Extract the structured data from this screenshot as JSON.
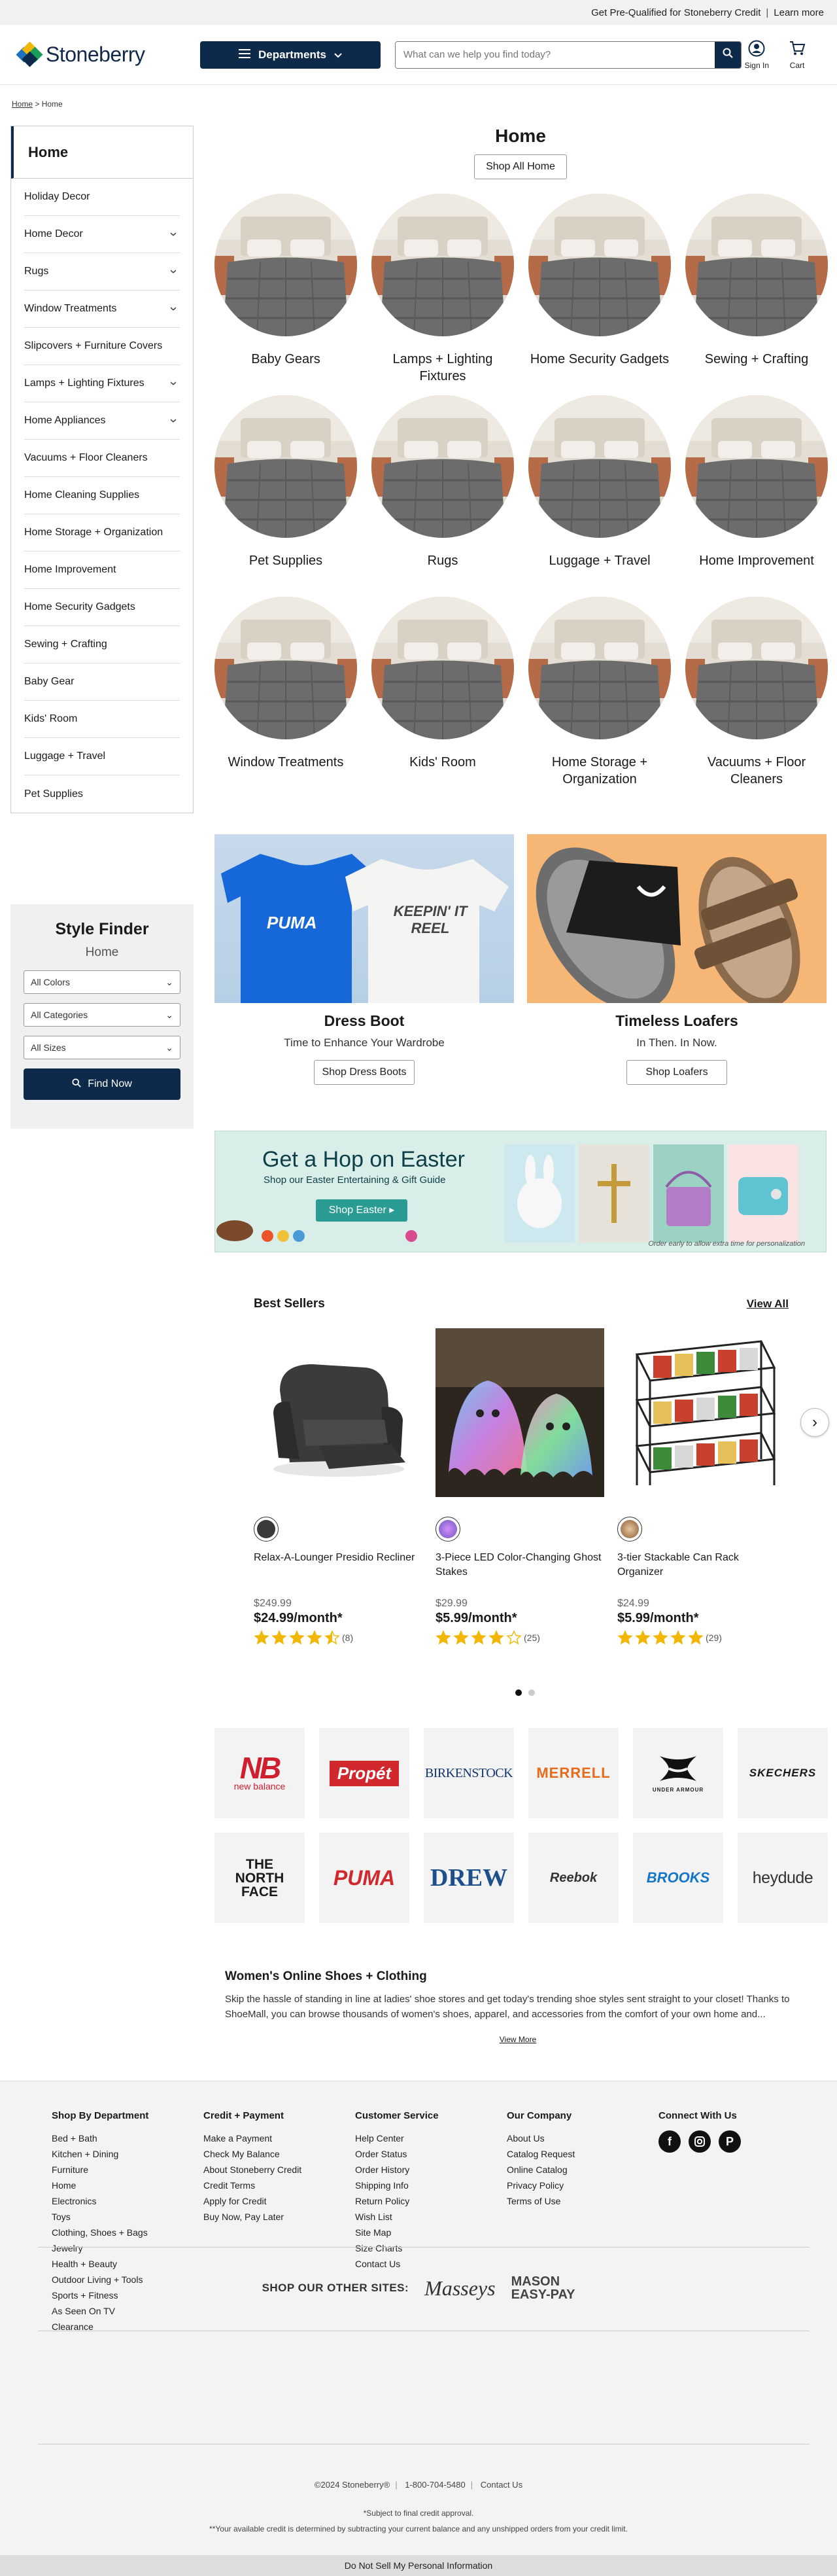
{
  "topbar": {
    "credit_text": "Get Pre-Qualified for Stoneberry Credit",
    "sep": "|",
    "learn_more": "Learn more"
  },
  "header": {
    "logo_text": "Stoneberry",
    "departments_label": "Departments",
    "search_placeholder": "What can we help you find today?",
    "signin_label": "Sign In",
    "cart_label": "Cart"
  },
  "breadcrumb": {
    "home": "Home",
    "sep": ">",
    "current": "Home"
  },
  "sidebar": {
    "title": "Home",
    "items": [
      {
        "label": "Holiday Decor",
        "expandable": false
      },
      {
        "label": "Home Decor",
        "expandable": true
      },
      {
        "label": "Rugs",
        "expandable": true
      },
      {
        "label": "Window Treatments",
        "expandable": true
      },
      {
        "label": "Slipcovers + Furniture Covers",
        "expandable": false
      },
      {
        "label": "Lamps + Lighting Fixtures",
        "expandable": true
      },
      {
        "label": "Home Appliances",
        "expandable": true
      },
      {
        "label": "Vacuums + Floor Cleaners",
        "expandable": false
      },
      {
        "label": "Home Cleaning Supplies",
        "expandable": false
      },
      {
        "label": "Home Storage + Organization",
        "expandable": false
      },
      {
        "label": "Home Improvement",
        "expandable": false
      },
      {
        "label": "Home Security Gadgets",
        "expandable": false
      },
      {
        "label": "Sewing + Crafting",
        "expandable": false
      },
      {
        "label": "Baby Gear",
        "expandable": false
      },
      {
        "label": "Kids' Room",
        "expandable": false
      },
      {
        "label": "Luggage + Travel",
        "expandable": false
      },
      {
        "label": "Pet Supplies",
        "expandable": false
      }
    ]
  },
  "style_finder": {
    "title": "Style Finder",
    "subtitle": "Home",
    "colors": "All Colors",
    "categories": "All Categories",
    "sizes": "All Sizes",
    "button": "Find Now"
  },
  "main": {
    "title": "Home",
    "shop_all": "Shop All Home",
    "categories": [
      "Baby Gears",
      "Lamps + Lighting Fixtures",
      "Home Security Gadgets",
      "Sewing + Crafting",
      "Pet Supplies",
      "Rugs",
      "Luggage + Travel",
      "Home Improvement",
      "Window Treatments",
      "Kids' Room",
      "Home Storage + Organization",
      "Vacuums + Floor Cleaners"
    ]
  },
  "promos": [
    {
      "title": "Dress Boot",
      "subtitle": "Time to Enhance Your Wardrobe",
      "button": "Shop Dress Boots",
      "shirt1": "PUMA",
      "shirt2": "KEEPIN' IT REEL"
    },
    {
      "title": "Timeless Loafers",
      "subtitle": "In Then. In Now.",
      "button": "Shop Loafers"
    }
  ],
  "easter": {
    "headline": "Get a Hop on Easter",
    "subline": "Shop our Easter Entertaining & Gift Guide",
    "button": "Shop Easter",
    "note": "Order early to allow extra time for personalization"
  },
  "best_sellers": {
    "title": "Best Sellers",
    "view_all": "View All",
    "products": [
      {
        "name": "Relax-A-Lounger Presidio Recliner",
        "was": "$249.99",
        "price": "$24.99/month*",
        "rating": 4.5,
        "reviews": "(8)",
        "swatch": "#3a3a3a"
      },
      {
        "name": "3-Piece LED Color-Changing Ghost Stakes",
        "was": "$29.99",
        "price": "$5.99/month*",
        "rating": 4,
        "reviews": "(25)",
        "swatch": "#8a6fc4"
      },
      {
        "name": "3-tier Stackable Can Rack Organizer",
        "was": "$24.99",
        "price": "$5.99/month*",
        "rating": 5,
        "reviews": "(29)",
        "swatch": "#b07a4a"
      }
    ],
    "page_count": 2,
    "active_page": 1
  },
  "brands": [
    {
      "name": "new balance",
      "label": "NB"
    },
    {
      "name": "Propét",
      "label": "Propét"
    },
    {
      "name": "BIRKENSTOCK",
      "label": "BIRKENSTOCK"
    },
    {
      "name": "MERRELL",
      "label": "MERRELL"
    },
    {
      "name": "UNDER ARMOUR",
      "label": "UNDER ARMOUR"
    },
    {
      "name": "SKECHERS",
      "label": "SKECHERS"
    },
    {
      "name": "THE NORTH FACE",
      "label": "THE NORTH FACE"
    },
    {
      "name": "PUMA",
      "label": "PUMA"
    },
    {
      "name": "DREW",
      "label": "DREW"
    },
    {
      "name": "Reebok",
      "label": "Reebok"
    },
    {
      "name": "BROOKS",
      "label": "BROOKS"
    },
    {
      "name": "hey dude",
      "label": "heydude"
    }
  ],
  "seo": {
    "title": "Women's Online Shoes + Clothing",
    "text": "Skip the hassle of standing in line at ladies' shoe stores and get today's trending shoe styles sent straight to your closet! Thanks to ShoeMall, you can browse thousands of women's shoes, apparel, and accessories from the comfort of your own home and...",
    "more": "View More"
  },
  "footer": {
    "columns": [
      {
        "title": "Shop By Department",
        "links": [
          "Bed + Bath",
          "Kitchen + Dining",
          "Furniture",
          "Home",
          "Electronics",
          "Toys",
          "Clothing, Shoes + Bags",
          "Jewelry",
          "Health + Beauty",
          "Outdoor Living + Tools",
          "Sports + Fitness",
          "As Seen On TV",
          "Clearance"
        ]
      },
      {
        "title": "Credit + Payment",
        "links": [
          "Make a Payment",
          "Check My Balance",
          "About Stoneberry Credit",
          "Credit Terms",
          "Apply for Credit",
          "Buy Now, Pay Later"
        ]
      },
      {
        "title": "Customer Service",
        "links": [
          "Help Center",
          "Order Status",
          "Order History",
          "Shipping Info",
          "Return Policy",
          "Wish List",
          "Site Map",
          "Size Charts",
          "Contact Us"
        ]
      },
      {
        "title": "Our Company",
        "links": [
          "About Us",
          "Catalog Request",
          "Online Catalog",
          "Privacy Policy",
          "Terms of Use"
        ]
      }
    ],
    "connect_title": "Connect With Us",
    "other_sites_label": "SHOP OUR OTHER SITES:",
    "masseys": "Masseys",
    "mason_line1": "MASON",
    "mason_line2": "EASY-PAY",
    "copyright": "©2024 Stoneberry®",
    "phone": "1-800-704-5480",
    "contact": "Contact Us",
    "fine1": "*Subject to final credit approval.",
    "fine2": "**Your available credit is determined by subtracting your current balance and any unshipped orders from your credit limit.",
    "dns": "Do Not Sell My Personal Information"
  },
  "colors": {
    "navy": "#0e2a4a",
    "star": "#f2b705"
  }
}
